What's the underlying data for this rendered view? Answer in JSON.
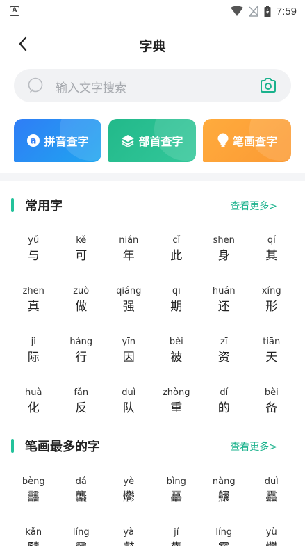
{
  "status": {
    "left_badge": "A",
    "time": "7:59"
  },
  "header": {
    "title": "字典"
  },
  "search": {
    "placeholder": "输入文字搜索"
  },
  "categories": [
    {
      "label": "拼音查字",
      "color": "#2f7df6",
      "icon": "pinyin-a-icon"
    },
    {
      "label": "部首查字",
      "color": "#22b98a",
      "icon": "layers-icon"
    },
    {
      "label": "笔画查字",
      "color": "#fb9a34",
      "icon": "lightbulb-icon"
    }
  ],
  "common": {
    "title": "常用字",
    "more": "查看更多>",
    "chars": [
      {
        "py": "yǔ",
        "hz": "与"
      },
      {
        "py": "kě",
        "hz": "可"
      },
      {
        "py": "nián",
        "hz": "年"
      },
      {
        "py": "cǐ",
        "hz": "此"
      },
      {
        "py": "shēn",
        "hz": "身"
      },
      {
        "py": "qí",
        "hz": "其"
      },
      {
        "py": "zhēn",
        "hz": "真"
      },
      {
        "py": "zuò",
        "hz": "做"
      },
      {
        "py": "qiáng",
        "hz": "强"
      },
      {
        "py": "qī",
        "hz": "期"
      },
      {
        "py": "huán",
        "hz": "还"
      },
      {
        "py": "xíng",
        "hz": "形"
      },
      {
        "py": "jì",
        "hz": "际"
      },
      {
        "py": "háng",
        "hz": "行"
      },
      {
        "py": "yīn",
        "hz": "因"
      },
      {
        "py": "bèi",
        "hz": "被"
      },
      {
        "py": "zī",
        "hz": "资"
      },
      {
        "py": "tiān",
        "hz": "天"
      },
      {
        "py": "huà",
        "hz": "化"
      },
      {
        "py": "fǎn",
        "hz": "反"
      },
      {
        "py": "duì",
        "hz": "队"
      },
      {
        "py": "zhòng",
        "hz": "重"
      },
      {
        "py": "dí",
        "hz": "的"
      },
      {
        "py": "bèi",
        "hz": "备"
      }
    ]
  },
  "strokes": {
    "title": "笔画最多的字",
    "more": "查看更多>",
    "chars": [
      {
        "py": "bèng",
        "hz": "䨻"
      },
      {
        "py": "dá",
        "hz": "龘"
      },
      {
        "py": "yè",
        "hz": "爩"
      },
      {
        "py": "bìng",
        "hz": "靐"
      },
      {
        "py": "nàng",
        "hz": "齉"
      },
      {
        "py": "duì",
        "hz": "䨺"
      },
      {
        "py": "kǎn",
        "hz": "䬞"
      },
      {
        "py": "líng",
        "hz": "龗"
      },
      {
        "py": "yà",
        "hz": "齾"
      },
      {
        "py": "jí",
        "hz": "雧"
      },
      {
        "py": "líng",
        "hz": "靇"
      },
      {
        "py": "yù",
        "hz": "爩"
      }
    ]
  },
  "colors": {
    "accent": "#23c29b",
    "search_bg": "#f1f2f4"
  }
}
